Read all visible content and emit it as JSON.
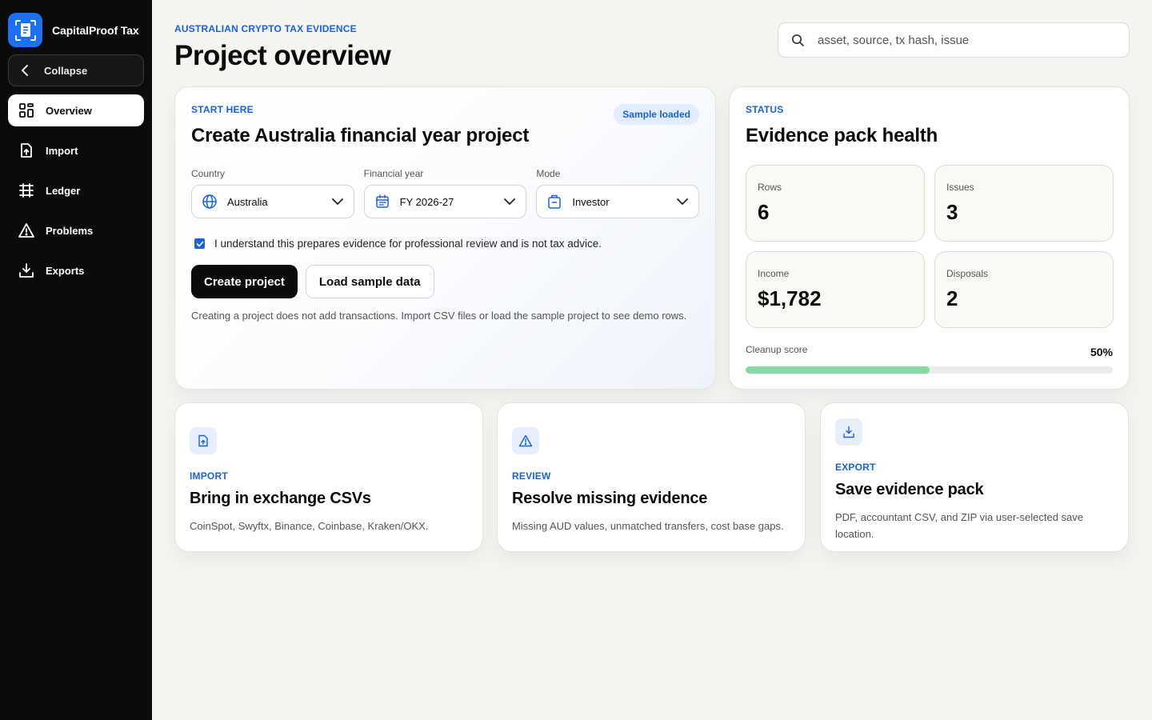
{
  "app": {
    "name": "CapitalProof Tax"
  },
  "sidebar": {
    "collapse_label": "Collapse",
    "items": [
      {
        "label": "Overview",
        "icon": "grid-icon",
        "active": true
      },
      {
        "label": "Import",
        "icon": "file-upload-icon",
        "active": false
      },
      {
        "label": "Ledger",
        "icon": "table-icon",
        "active": false
      },
      {
        "label": "Problems",
        "icon": "warning-icon",
        "active": false
      },
      {
        "label": "Exports",
        "icon": "download-icon",
        "active": false
      }
    ]
  },
  "header": {
    "eyebrow": "AUSTRALIAN CRYPTO TAX EVIDENCE",
    "title": "Project overview",
    "search_placeholder": "asset, source, tx hash, issue"
  },
  "start": {
    "eyebrow": "START HERE",
    "title": "Create Australia financial year project",
    "badge": "Sample loaded",
    "fields": {
      "country": {
        "label": "Country",
        "value": "Australia",
        "icon": "globe-icon"
      },
      "year": {
        "label": "Financial year",
        "value": "FY 2026-27",
        "icon": "calendar-icon"
      },
      "mode": {
        "label": "Mode",
        "value": "Investor",
        "icon": "briefcase-icon"
      }
    },
    "consent": {
      "label": "I understand this prepares evidence for professional review and is not tax advice.",
      "checked": true
    },
    "create_label": "Create project",
    "sample_label": "Load sample data",
    "helper": "Creating a project does not add transactions. Import CSV files or load the sample project to see demo rows."
  },
  "status": {
    "eyebrow": "STATUS",
    "title": "Evidence pack health",
    "stats": [
      {
        "label": "Rows",
        "value": "6"
      },
      {
        "label": "Issues",
        "value": "3"
      },
      {
        "label": "Income",
        "value": "$1,782"
      },
      {
        "label": "Disposals",
        "value": "2"
      }
    ],
    "cleanup_label": "Cleanup score",
    "cleanup_value": "50%",
    "cleanup_fraction": 0.5
  },
  "cards": [
    {
      "eyebrow": "IMPORT",
      "title": "Bring in exchange CSVs",
      "desc": "CoinSpot, Swyftx, Binance, Coinbase, Kraken/OKX.",
      "icon": "file-upload-icon"
    },
    {
      "eyebrow": "REVIEW",
      "title": "Resolve missing evidence",
      "desc": "Missing AUD values, unmatched transfers, cost base gaps.",
      "icon": "warning-icon"
    },
    {
      "eyebrow": "EXPORT",
      "title": "Save evidence pack",
      "desc": "PDF, accountant CSV, and ZIP via user-selected save location.",
      "icon": "download-icon"
    }
  ],
  "colors": {
    "accent": "#1a62d8",
    "sidebar": "#0b0b0b",
    "progress": "#86d9a2",
    "badge_bg": "#e2edff"
  }
}
